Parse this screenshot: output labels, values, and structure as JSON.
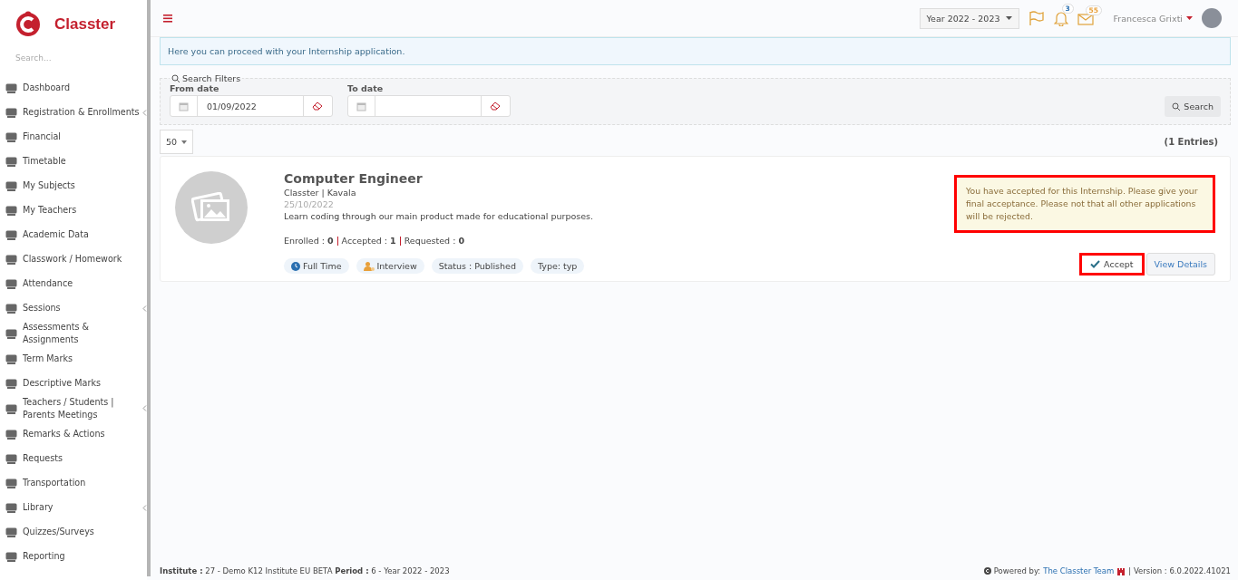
{
  "brand": {
    "name": "Classter"
  },
  "sidebar": {
    "search_placeholder": "Search...",
    "items": [
      {
        "label": "Dashboard",
        "has_submenu": false
      },
      {
        "label": "Registration & Enrollments",
        "has_submenu": true
      },
      {
        "label": "Financial",
        "has_submenu": false
      },
      {
        "label": "Timetable",
        "has_submenu": false
      },
      {
        "label": "My Subjects",
        "has_submenu": false
      },
      {
        "label": "My Teachers",
        "has_submenu": false
      },
      {
        "label": "Academic Data",
        "has_submenu": false
      },
      {
        "label": "Classwork / Homework",
        "has_submenu": false
      },
      {
        "label": "Attendance",
        "has_submenu": false
      },
      {
        "label": "Sessions",
        "has_submenu": true
      },
      {
        "label": "Assessments & Assignments",
        "has_submenu": false
      },
      {
        "label": "Term Marks",
        "has_submenu": false
      },
      {
        "label": "Descriptive Marks",
        "has_submenu": false
      },
      {
        "label": "Teachers / Students | Parents Meetings",
        "has_submenu": true
      },
      {
        "label": "Remarks & Actions",
        "has_submenu": false
      },
      {
        "label": "Requests",
        "has_submenu": false
      },
      {
        "label": "Transportation",
        "has_submenu": false
      },
      {
        "label": "Library",
        "has_submenu": true
      },
      {
        "label": "Quizzes/Surveys",
        "has_submenu": false
      },
      {
        "label": "Reporting",
        "has_submenu": false
      }
    ]
  },
  "topbar": {
    "year": "Year 2022 - 2023",
    "notifications": "3",
    "messages": "55",
    "user": "Francesca Grixti"
  },
  "info": "Here you can proceed with your Internship application.",
  "filters": {
    "title": "Search Filters",
    "from_label": "From date",
    "from_value": "01/09/2022",
    "to_label": "To date",
    "search_button": "Search"
  },
  "page_size": "50",
  "entries": "(1 Entries)",
  "internship": {
    "title": "Computer Engineer",
    "company": "Classter | Kavala",
    "date": "25/10/2022",
    "description": "Learn coding through our main product made for educational purposes.",
    "stats": [
      {
        "label": "Enrolled : ",
        "value": "0"
      },
      {
        "label": "Accepted : ",
        "value": "1"
      },
      {
        "label": "Requested : ",
        "value": "0"
      }
    ],
    "tags": [
      {
        "kind": "clock",
        "label": "Full Time"
      },
      {
        "kind": "person",
        "label": "Interview"
      },
      {
        "kind": "plain",
        "label": "Status : Published"
      },
      {
        "kind": "plain",
        "label": "Type: typ"
      }
    ],
    "notice": {
      "text": "You have accepted for this Internship. Please give your final acceptance. Please not that all other applications will be rejected.",
      "highlighted": true
    },
    "accept": {
      "label": "Accept",
      "highlighted": true
    },
    "details": "View Details"
  },
  "footer": {
    "left": "**Institute :** 27 - Demo K12 Institute EU BETA **Period :** 6 - Year 2022 - 2023",
    "powered": "Powered by:",
    "team": "The Classter Team",
    "version": "| Version : 6.0.2022.41021"
  }
}
